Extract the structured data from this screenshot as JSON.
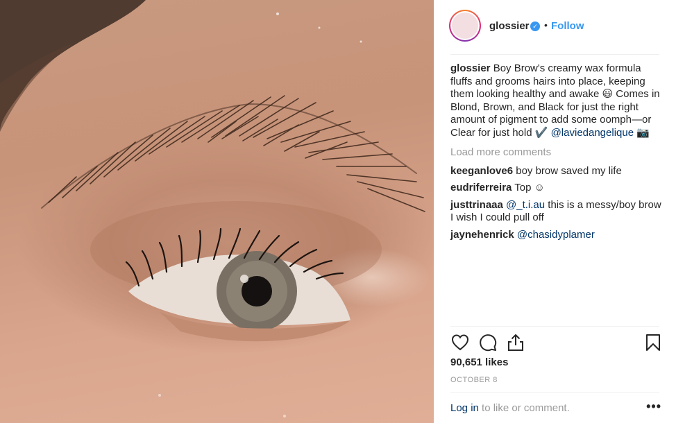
{
  "post": {
    "image_alt": "Close-up of an eye and brow",
    "account": {
      "username": "glossier",
      "verified_badge": "✓",
      "separator": "•",
      "follow_label": "Follow"
    },
    "caption": {
      "username": "glossier",
      "text": "Boy Brow's creamy wax formula fluffs and grooms hairs into place, keeping them looking healthy and awake 😃  Comes in Blond, Brown, and Black for just the right amount of pigment to add some oomph—or Clear for just hold ✔️ ",
      "mention": "@laviedangelique",
      "suffix": " 📷"
    },
    "load_more_label": "Load more comments",
    "comments": [
      {
        "username": "keeganlove6",
        "text": " boy brow saved my life",
        "mention": ""
      },
      {
        "username": "eudriferreira",
        "text": " Top ☺",
        "mention": ""
      },
      {
        "username": "justtrinaaa",
        "text": " this is a messy/boy brow I wish I could pull off",
        "mention": "@_t.i.au"
      },
      {
        "username": "jaynehenrick",
        "text": "",
        "mention": "@chasidyplamer"
      }
    ],
    "likes_text": "90,651 likes",
    "date_text": "OCTOBER 8",
    "login": {
      "link_label": "Log in",
      "rest": " to like or comment."
    },
    "more_options_label": "•••",
    "icons": [
      "heart-icon",
      "comment-icon",
      "share-icon",
      "bookmark-icon"
    ],
    "colors": {
      "link_blue": "#3897f0",
      "mention_blue": "#003569",
      "muted_gray": "#999999"
    }
  }
}
